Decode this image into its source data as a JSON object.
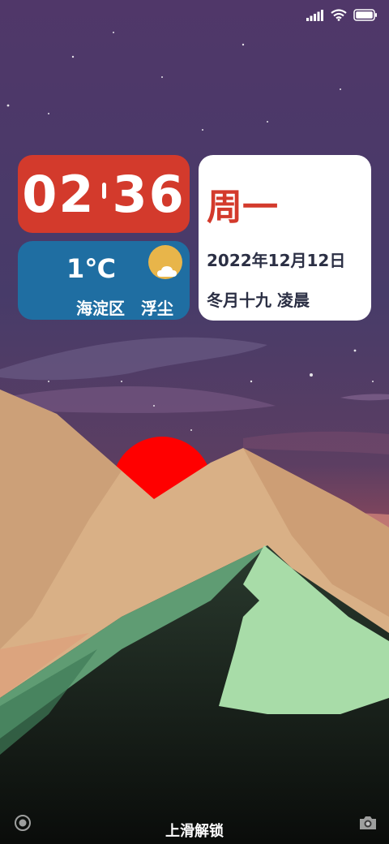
{
  "status_bar": {
    "icons": [
      "cellular-signal-icon",
      "wifi-icon",
      "battery-icon"
    ]
  },
  "clock": {
    "hours": "02",
    "minutes": "36"
  },
  "weather": {
    "temperature": "1℃",
    "location": "海淀区",
    "condition": "浮尘",
    "icon": "sun-behind-cloud-icon"
  },
  "calendar": {
    "weekday": "周一",
    "date": "2022年12月12日",
    "lunar": "冬月十九 凌晨"
  },
  "bottom": {
    "unlock_text": "上滑解锁",
    "left_icon": "camera-lens-icon",
    "right_icon": "camera-icon"
  },
  "colors": {
    "clock_bg": "#d33a2c",
    "weather_bg": "#1f6ea2",
    "calendar_bg": "#ffffff",
    "accent_red": "#d33a2c",
    "sun": "#ff0000"
  }
}
